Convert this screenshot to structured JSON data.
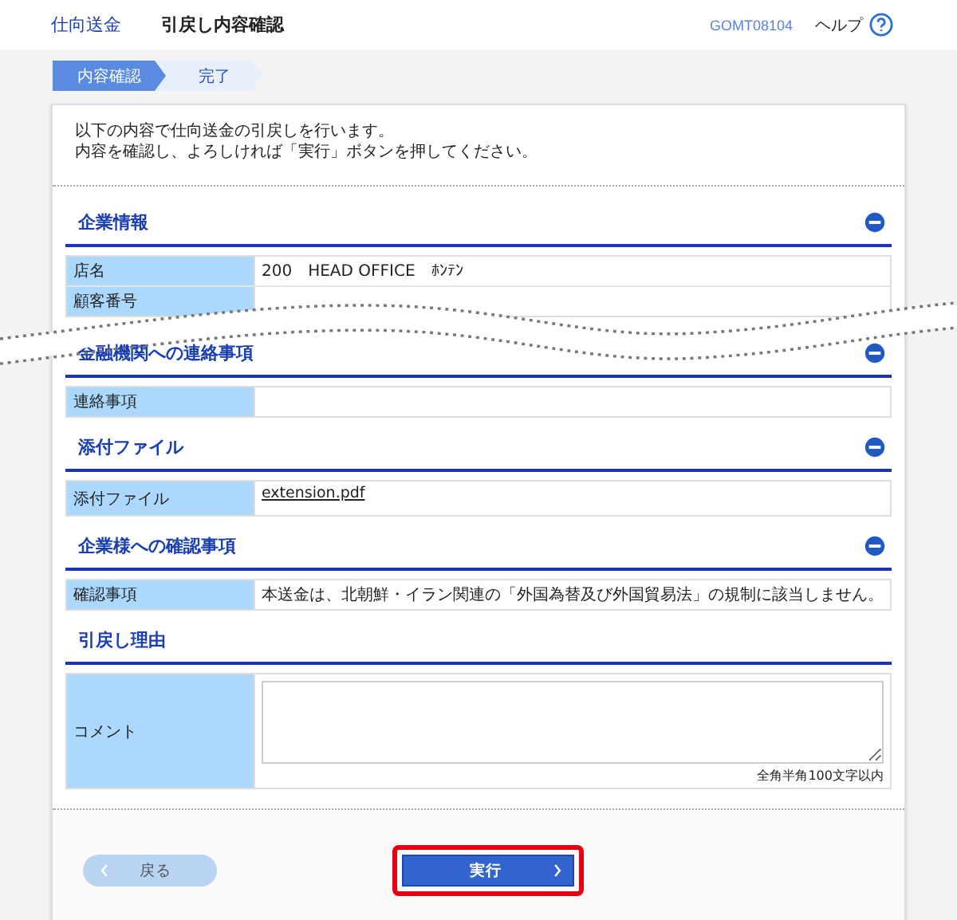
{
  "header": {
    "service": "仕向送金",
    "title": "引戻し内容確認",
    "screen_id": "GOMT08104",
    "help": "ヘルプ"
  },
  "steps": [
    {
      "label": "内容確認",
      "selected": true
    },
    {
      "label": "完了",
      "selected": false
    }
  ],
  "intro": [
    "以下の内容で仕向送金の引戻しを行います。",
    "内容を確認し、よろしければ「実行」ボタンを押してください。"
  ],
  "sections": [
    {
      "kind": "section",
      "title": "企業情報",
      "collapsible": true,
      "rows": [
        {
          "label": "店名",
          "value": "200　HEAD OFFICE　ﾎﾝﾃﾝ"
        },
        {
          "label": "顧客番号"
        }
      ]
    },
    {
      "kind": "cut"
    },
    {
      "kind": "section",
      "title": "金融機関への連絡事項",
      "collapsible": true,
      "rows": [
        {
          "label": "連絡事項"
        }
      ]
    },
    {
      "kind": "section",
      "title": "添付ファイル",
      "collapsible": true,
      "rows": [
        {
          "label": "添付ファイル",
          "value": "extension.pdf",
          "link": true,
          "tall": true
        }
      ]
    },
    {
      "kind": "section",
      "title": "企業様への確認事項",
      "collapsible": true,
      "rows": [
        {
          "label": "確認事項",
          "value": "本送金は、北朝鮮・イラン関連の「外国為替及び外国貿易法」の規制に該当しません。"
        }
      ]
    },
    {
      "kind": "section",
      "title": "引戻し理由",
      "collapsible": false,
      "rows": [
        {
          "label": "コメント",
          "field": true,
          "note": "全角半角100文字以内"
        }
      ]
    }
  ],
  "buttons": [
    {
      "kind": "back",
      "label": "戻る",
      "disabled": true,
      "highlighted": false
    },
    {
      "kind": "next",
      "label": "実行",
      "disabled": false,
      "highlighted": true
    }
  ]
}
